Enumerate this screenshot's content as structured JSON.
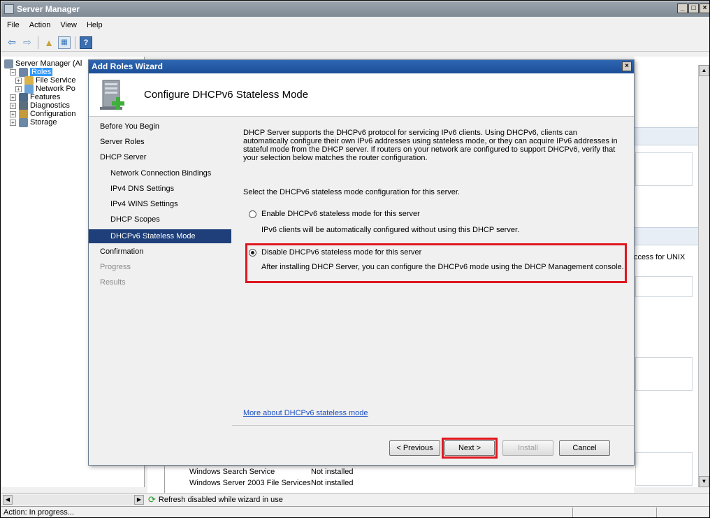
{
  "main_window": {
    "title": "Server Manager",
    "menu": [
      "File",
      "Action",
      "View",
      "Help"
    ],
    "tree": [
      {
        "label": "Server Manager (Al",
        "indent": 0,
        "exp": "",
        "icon": "server-manager-icon",
        "color": "#7d8fa6"
      },
      {
        "label": "Roles",
        "indent": 1,
        "exp": "−",
        "icon": "roles-icon",
        "color": "#6d86a8",
        "selected": true
      },
      {
        "label": "File Service",
        "indent": 2,
        "exp": "+",
        "icon": "file-services-icon",
        "color": "#d9b24a"
      },
      {
        "label": "Network Po",
        "indent": 2,
        "exp": "+",
        "icon": "network-policy-icon",
        "color": "#6aa3d9"
      },
      {
        "label": "Features",
        "indent": 1,
        "exp": "+",
        "icon": "features-icon",
        "color": "#4d6a89"
      },
      {
        "label": "Diagnostics",
        "indent": 1,
        "exp": "+",
        "icon": "diagnostics-icon",
        "color": "#5c6e7e"
      },
      {
        "label": "Configuration",
        "indent": 1,
        "exp": "+",
        "icon": "configuration-icon",
        "color": "#c49a3c"
      },
      {
        "label": "Storage",
        "indent": 1,
        "exp": "+",
        "icon": "storage-icon",
        "color": "#6b88a6"
      }
    ],
    "right_partial_text": "ccess for UNIX",
    "bottom_list": [
      {
        "name": "Windows Search Service",
        "status": "Not installed"
      },
      {
        "name": "Windows Server 2003 File Services",
        "status": "Not installed"
      }
    ],
    "refresh_message": "Refresh disabled while wizard in use",
    "status": "Action:  In progress..."
  },
  "wizard": {
    "title": "Add Roles Wizard",
    "page_title": "Configure DHCPv6 Stateless Mode",
    "nav": [
      {
        "label": "Before You Begin",
        "kind": "top"
      },
      {
        "label": "Server Roles",
        "kind": "top"
      },
      {
        "label": "DHCP Server",
        "kind": "top"
      },
      {
        "label": "Network Connection Bindings",
        "kind": "sub"
      },
      {
        "label": "IPv4 DNS Settings",
        "kind": "sub"
      },
      {
        "label": "IPv4 WINS Settings",
        "kind": "sub"
      },
      {
        "label": "DHCP Scopes",
        "kind": "sub"
      },
      {
        "label": "DHCPv6 Stateless Mode",
        "kind": "sel"
      },
      {
        "label": "Confirmation",
        "kind": "top"
      },
      {
        "label": "Progress",
        "kind": "dim"
      },
      {
        "label": "Results",
        "kind": "dim"
      }
    ],
    "description": "DHCP Server supports the DHCPv6 protocol for servicing IPv6 clients. Using DHCPv6, clients can automatically configure their own IPv6 addresses using stateless mode, or they can acquire IPv6 addresses in stateful mode from the DHCP server. If routers on your network are configured to support DHCPv6, verify that your selection below matches the router configuration.",
    "prompt": "Select the DHCPv6 stateless mode configuration for this server.",
    "option_enable": {
      "label": "Enable DHCPv6 stateless mode for this server",
      "note": "IPv6 clients will be automatically configured without using this DHCP server.",
      "selected": false
    },
    "option_disable": {
      "label": "Disable DHCPv6 stateless mode for this server",
      "note": "After installing DHCP Server, you can configure the DHCPv6 mode using the DHCP Management console.",
      "selected": true
    },
    "more_link": "More about DHCPv6 stateless mode",
    "buttons": {
      "previous": "< Previous",
      "next": "Next >",
      "install": "Install",
      "cancel": "Cancel"
    }
  },
  "colors": {
    "highlight_border": "#e0161e",
    "nav_selected": "#1e3f7a",
    "title_bar": "#1c4e97"
  }
}
